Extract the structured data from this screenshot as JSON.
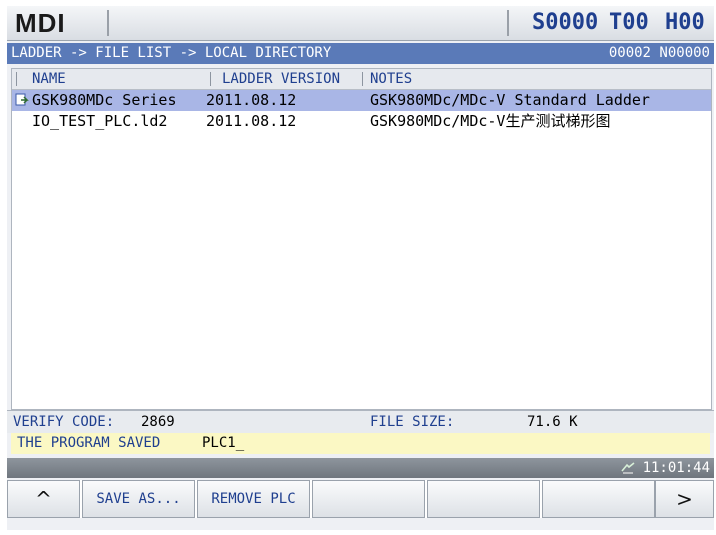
{
  "header": {
    "mode": "MDI",
    "spindle": "S0000",
    "tool": "T00",
    "h_offset": "H00"
  },
  "path_bar": {
    "path": "LADDER -> FILE LIST -> LOCAL DIRECTORY",
    "program_number": "00002 N00000"
  },
  "file_list": {
    "columns": [
      "NAME",
      "LADDER VERSION",
      "NOTES"
    ],
    "rows": [
      {
        "name": "GSK980MDc Series",
        "version": "2011.08.12",
        "notes": "GSK980MDc/MDc-V Standard Ladder",
        "selected": true,
        "icon": "ladder-file-icon"
      },
      {
        "name": "IO_TEST_PLC.ld2",
        "version": "2011.08.12",
        "notes": "GSK980MDc/MDc-V生产测试梯形图",
        "selected": false,
        "icon": ""
      }
    ]
  },
  "info": {
    "verify_label": "VERIFY CODE:",
    "verify_value": "2869",
    "size_label": "FILE SIZE:",
    "size_value": "71.6 K"
  },
  "message": {
    "label": "THE PROGRAM SAVED",
    "value": "PLC1_"
  },
  "status": {
    "time": "11:01:44",
    "icon": "clock-icon"
  },
  "softkeys": [
    "^",
    "SAVE AS...",
    "REMOVE PLC",
    "",
    "",
    "",
    "",
    ">"
  ],
  "colors": {
    "path_bar": "#5a7ab8",
    "selected_row": "#a9b6e6",
    "label_blue": "#1f3f8f",
    "message_bg": "#fbf8c4"
  }
}
